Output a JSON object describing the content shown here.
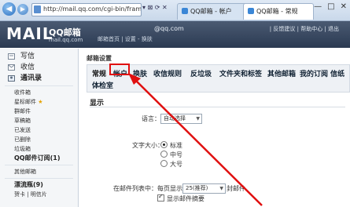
{
  "browser": {
    "url": "http://mail.qq.com/cgi-bin/frame_html?sid=H",
    "address_controls": "▾ ⊠ ⟳ ✕",
    "tabs": [
      {
        "label": "QQ邮箱 - 帐户"
      },
      {
        "label": "QQ邮箱 - 常规"
      }
    ],
    "window_controls": [
      "—",
      "□",
      "✕"
    ]
  },
  "header": {
    "logo": "MAIL",
    "logo_cn": "QQ邮箱",
    "logo_sub": "mail.qq.com",
    "email": "@qq.com",
    "links": "邮箱首页 | 设置 - 换肤",
    "right_links": "| 反馈建议 | 帮助中心 | 退出"
  },
  "sidebar": {
    "main": [
      {
        "label": "写信"
      },
      {
        "label": "收信"
      },
      {
        "label": "通讯录"
      }
    ],
    "folders": [
      {
        "label": "收件箱"
      },
      {
        "label": "星标邮件"
      },
      {
        "label": "群邮件"
      },
      {
        "label": "草稿箱"
      },
      {
        "label": "已发送"
      },
      {
        "label": "已删除"
      },
      {
        "label": "垃圾箱"
      },
      {
        "label": "QQ邮件订阅(1)"
      }
    ],
    "other": [
      {
        "label": "其他邮箱"
      },
      {
        "label": "漂流瓶(9)"
      },
      {
        "label": "贺卡 | 明信片"
      }
    ]
  },
  "settings": {
    "crumb": "邮箱设置",
    "tabs_row1": [
      "常规",
      "帐户",
      "换肤",
      "收信规则",
      "反垃圾",
      "文件夹和标签",
      "其他邮箱",
      "我的订阅",
      "信纸"
    ],
    "tabs_row2": [
      "体检室"
    ],
    "section": "显示",
    "language_label": "语言：",
    "language_value": "自动选择",
    "font_label": "文字大小：",
    "font_options": [
      "标准",
      "中号",
      "大号"
    ],
    "list_label": "在邮件列表中：",
    "per_page": "每页显示",
    "per_page_value": "25(推荐)",
    "per_page_unit": "封邮件",
    "show_summary": "显示邮件摘要"
  }
}
